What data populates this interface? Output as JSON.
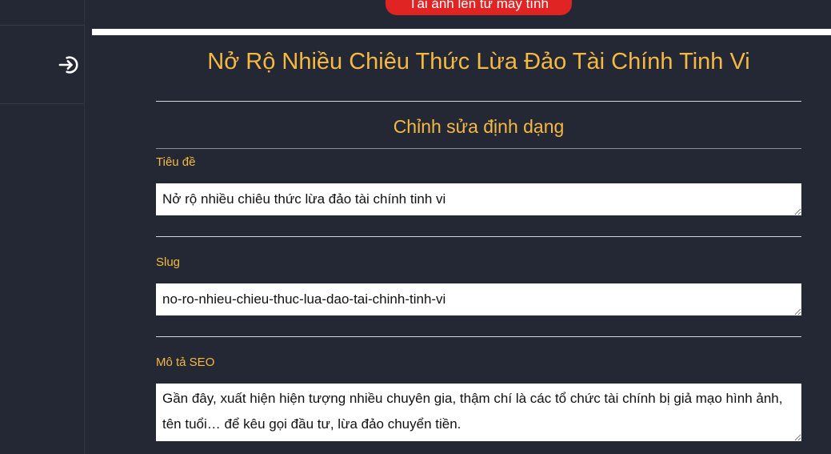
{
  "toolbar": {
    "upload_label": "Tải ảnh lên từ máy tính"
  },
  "sidebar": {
    "icons": [
      "logout-icon"
    ]
  },
  "article": {
    "title": "Nở Rộ Nhiều Chiêu Thức Lừa Đảo Tài Chính Tinh Vi"
  },
  "editor": {
    "heading": "Chỉnh sửa định dạng",
    "fields": [
      {
        "label": "Tiêu đề",
        "value": "Nở rộ nhiều chiêu thức lừa đảo tài chính tinh vi"
      },
      {
        "label": "Slug",
        "value": "no-ro-nhieu-chieu-thuc-lua-dao-tai-chinh-tinh-vi"
      },
      {
        "label": "Mô tả SEO",
        "value": "Gần đây, xuất hiện hiện tượng nhiều chuyên gia, thậm chí là các tổ chức tài chính bị giả mạo hình ảnh, tên tuổi… để kêu gọi đầu tư, lừa đảo chuyển tiền."
      }
    ]
  },
  "colors": {
    "background": "#232834",
    "accent": "#f5b942",
    "button": "#e02424"
  }
}
